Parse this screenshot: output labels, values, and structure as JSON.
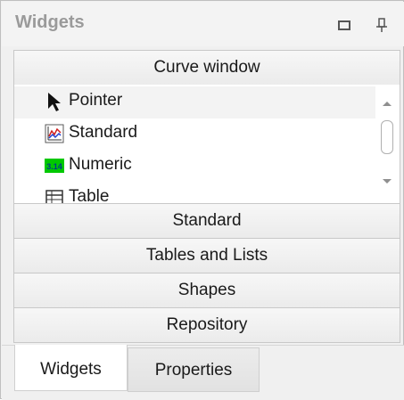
{
  "panel": {
    "title": "Widgets"
  },
  "groups": {
    "curve_window": "Curve window",
    "standard": "Standard",
    "tables_and_lists": "Tables and Lists",
    "shapes": "Shapes",
    "repository": "Repository"
  },
  "list": {
    "items": [
      {
        "label": "Pointer",
        "icon": "pointer-icon"
      },
      {
        "label": "Standard",
        "icon": "standard-chart-icon"
      },
      {
        "label": "Numeric",
        "icon": "numeric-icon",
        "icon_text": "3.14"
      },
      {
        "label": "Table",
        "icon": "table-icon"
      }
    ]
  },
  "tabs": [
    {
      "label": "Widgets",
      "active": true
    },
    {
      "label": "Properties",
      "active": false
    }
  ],
  "colors": {
    "numeric_icon_bg": "#00c800",
    "title_text": "#9a9a9a"
  }
}
